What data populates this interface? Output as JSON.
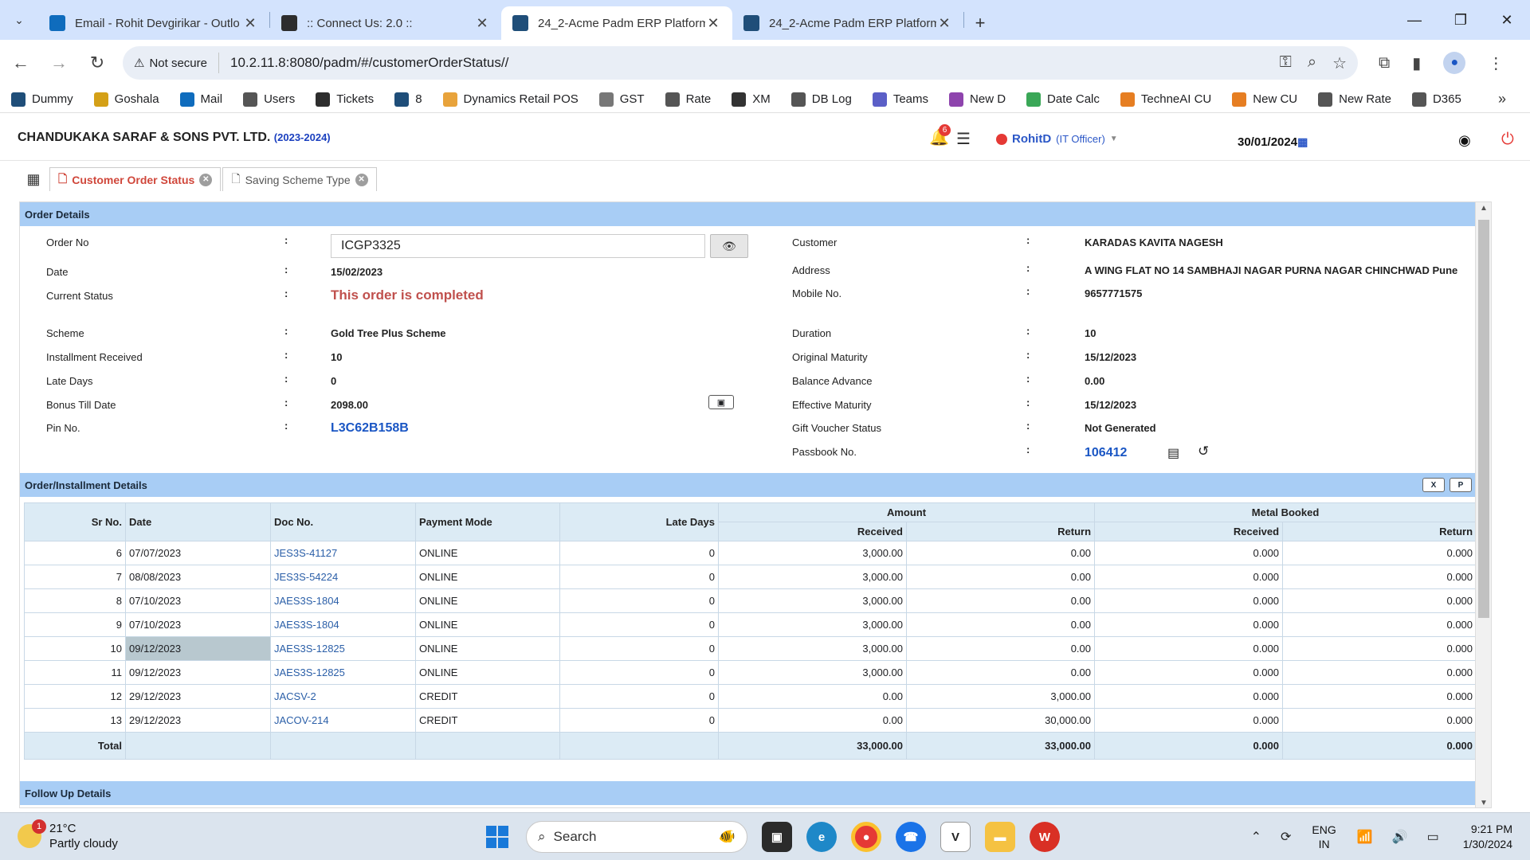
{
  "browser": {
    "tabs": [
      {
        "title": "Email - Rohit Devgirikar - Outlo",
        "favicon_color": "#0f6cbd",
        "active": false
      },
      {
        "title": ":: Connect Us: 2.0 ::",
        "favicon_color": "#2d2d2d",
        "active": false
      },
      {
        "title": "24_2-Acme Padm ERP Platform",
        "favicon_color": "#1f4e79",
        "active": true
      },
      {
        "title": "24_2-Acme Padm ERP Platform",
        "favicon_color": "#1f4e79",
        "active": false
      }
    ],
    "security_label": "Not secure",
    "url": "10.2.11.8:8080/padm/#/customerOrderStatus//",
    "bookmarks": [
      {
        "label": "Dummy",
        "color": "#1f4e79"
      },
      {
        "label": "Goshala",
        "color": "#d4a017"
      },
      {
        "label": "Mail",
        "color": "#0f6cbd"
      },
      {
        "label": "Users",
        "color": "#555555"
      },
      {
        "label": "Tickets",
        "color": "#2d2d2d"
      },
      {
        "label": "8",
        "color": "#1f4e79"
      },
      {
        "label": "Dynamics Retail POS",
        "color": "#e8a33b"
      },
      {
        "label": "GST",
        "color": "#777777"
      },
      {
        "label": "Rate",
        "color": "#555555"
      },
      {
        "label": "XM",
        "color": "#333333"
      },
      {
        "label": "DB Log",
        "color": "#555555"
      },
      {
        "label": "Teams",
        "color": "#5b5fc7"
      },
      {
        "label": "New D",
        "color": "#8e44ad"
      },
      {
        "label": "Date Calc",
        "color": "#3aa757"
      },
      {
        "label": "TechneAI CU",
        "color": "#e67e22"
      },
      {
        "label": "New CU",
        "color": "#e67e22"
      },
      {
        "label": "New Rate",
        "color": "#555555"
      },
      {
        "label": "D365",
        "color": "#555555"
      }
    ]
  },
  "app": {
    "company": "CHANDUKAKA SARAF & SONS PVT. LTD.",
    "fin_year": "(2023-2024)",
    "notification_count": "6",
    "user_name": "RohitD",
    "user_role": "(IT Officer)",
    "date": "30/01/2024",
    "tabs": [
      {
        "label": "Customer Order Status",
        "active": true
      },
      {
        "label": "Saving Scheme Type",
        "active": false
      }
    ]
  },
  "order": {
    "section_title": "Order Details",
    "labels": {
      "order_no": "Order No",
      "date": "Date",
      "current_status": "Current Status",
      "scheme": "Scheme",
      "installment_received": "Installment Received",
      "late_days": "Late Days",
      "bonus_till_date": "Bonus Till Date",
      "pin_no": "Pin No.",
      "customer": "Customer",
      "address": "Address",
      "mobile": "Mobile No.",
      "duration": "Duration",
      "original_maturity": "Original Maturity",
      "balance_advance": "Balance Advance",
      "effective_maturity": "Effective Maturity",
      "gift_voucher_status": "Gift Voucher Status",
      "passbook_no": "Passbook No."
    },
    "colon": ":",
    "order_no": "ICGP3325",
    "date": "15/02/2023",
    "current_status": "This order is completed",
    "scheme": "Gold Tree Plus Scheme",
    "installment_received": "10",
    "late_days": "0",
    "bonus_till_date": "2098.00",
    "pin_no": "L3C62B158B",
    "customer": "KARADAS KAVITA NAGESH",
    "address": "A WING FLAT NO 14 SAMBHAJI NAGAR PURNA NAGAR CHINCHWAD Pune",
    "mobile": "9657771575",
    "duration": "10",
    "original_maturity": "15/12/2023",
    "balance_advance": "0.00",
    "effective_maturity": "15/12/2023",
    "gift_voucher_status": "Not Generated",
    "passbook_no": "106412"
  },
  "installments": {
    "section_title": "Order/Installment Details",
    "headers": {
      "sr_no": "Sr No.",
      "date": "Date",
      "doc_no": "Doc No.",
      "payment_mode": "Payment Mode",
      "late_days": "Late Days",
      "amount": "Amount",
      "metal_booked": "Metal Booked",
      "received": "Received",
      "return": "Return"
    },
    "rows": [
      {
        "sr": "6",
        "date": "07/07/2023",
        "doc": "JES3S-41127",
        "mode": "ONLINE",
        "late": "0",
        "amt_recv": "3,000.00",
        "amt_ret": "0.00",
        "met_recv": "0.000",
        "met_ret": "0.000"
      },
      {
        "sr": "7",
        "date": "08/08/2023",
        "doc": "JES3S-54224",
        "mode": "ONLINE",
        "late": "0",
        "amt_recv": "3,000.00",
        "amt_ret": "0.00",
        "met_recv": "0.000",
        "met_ret": "0.000"
      },
      {
        "sr": "8",
        "date": "07/10/2023",
        "doc": "JAES3S-1804",
        "mode": "ONLINE",
        "late": "0",
        "amt_recv": "3,000.00",
        "amt_ret": "0.00",
        "met_recv": "0.000",
        "met_ret": "0.000"
      },
      {
        "sr": "9",
        "date": "07/10/2023",
        "doc": "JAES3S-1804",
        "mode": "ONLINE",
        "late": "0",
        "amt_recv": "3,000.00",
        "amt_ret": "0.00",
        "met_recv": "0.000",
        "met_ret": "0.000"
      },
      {
        "sr": "10",
        "date": "09/12/2023",
        "doc": "JAES3S-12825",
        "mode": "ONLINE",
        "late": "0",
        "amt_recv": "3,000.00",
        "amt_ret": "0.00",
        "met_recv": "0.000",
        "met_ret": "0.000"
      },
      {
        "sr": "11",
        "date": "09/12/2023",
        "doc": "JAES3S-12825",
        "mode": "ONLINE",
        "late": "0",
        "amt_recv": "3,000.00",
        "amt_ret": "0.00",
        "met_recv": "0.000",
        "met_ret": "0.000"
      },
      {
        "sr": "12",
        "date": "29/12/2023",
        "doc": "JACSV-2",
        "mode": "CREDIT",
        "late": "0",
        "amt_recv": "0.00",
        "amt_ret": "3,000.00",
        "met_recv": "0.000",
        "met_ret": "0.000"
      },
      {
        "sr": "13",
        "date": "29/12/2023",
        "doc": "JACOV-214",
        "mode": "CREDIT",
        "late": "0",
        "amt_recv": "0.00",
        "amt_ret": "30,000.00",
        "met_recv": "0.000",
        "met_ret": "0.000"
      }
    ],
    "total_label": "Total",
    "totals": {
      "amt_recv": "33,000.00",
      "amt_ret": "33,000.00",
      "met_recv": "0.000",
      "met_ret": "0.000"
    }
  },
  "followup": {
    "section_title": "Follow Up Details"
  },
  "taskbar": {
    "temperature": "21°C",
    "weather": "Partly cloudy",
    "weather_badge": "1",
    "search_placeholder": "Search",
    "lang_top": "ENG",
    "lang_bottom": "IN",
    "time": "9:21 PM",
    "date": "1/30/2024"
  }
}
